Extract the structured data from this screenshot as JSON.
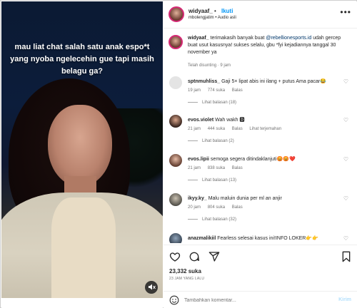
{
  "media": {
    "caption": "mau liat chat salah satu anak espo*t yang nyoba ngelecehin gue tapi masih belagu ga?"
  },
  "header": {
    "username": "widyaaf_",
    "separator": "•",
    "follow_label": "Ikuti",
    "subtitle": "mbolengjatim • Audio asli",
    "more": "•••"
  },
  "post_caption": {
    "username": "widyaaf_",
    "text_before": "terimakasih banyak buat",
    "mention": "@rebellionesports.id",
    "text_after": "udah gercep buat usut kasusnya! sukses selalu, gbu *fyi kejadiannya tanggal 30 november ya",
    "meta": "Telah disunting · 9 jam"
  },
  "comments": [
    {
      "username": "sptnmuhliss_",
      "text": "Gaji 5× lipat abis ini ilang + putus Ama pacar😂",
      "time": "19 jam",
      "likes": "774 suka",
      "reply": "Balas",
      "translate": "",
      "replies": "Lihat balasan (18)"
    },
    {
      "username": "evos.violet",
      "text": "Wah wakh 🅳",
      "time": "21 jam",
      "likes": "444 suka",
      "reply": "Balas",
      "translate": "Lihat terjemahan",
      "replies": "Lihat balasan (2)"
    },
    {
      "username": "evos.lipii",
      "text": "semoga segera ditindaklanjuti😡😡❤️",
      "time": "21 jam",
      "likes": "838 suka",
      "reply": "Balas",
      "translate": "",
      "replies": "Lihat balasan (13)"
    },
    {
      "username": "ikyy.ky_",
      "text": "Malu maluin dunia per ml an anjir",
      "time": "20 jam",
      "likes": "804 suka",
      "reply": "Balas",
      "translate": "",
      "replies": "Lihat balasan (32)"
    },
    {
      "username": "anazmalikiil",
      "text": "Fearless selesai kasus ini!INFO LOKER👉👉",
      "time": "",
      "likes": "",
      "reply": "",
      "translate": "",
      "replies": ""
    }
  ],
  "actions": {
    "likes": "23,332 suka",
    "ago": "23 JAM YANG LALU",
    "placeholder": "Tambahkan komentar...",
    "post_label": "Kirim"
  },
  "icons": {
    "like": "heart-icon",
    "comment": "comment-icon",
    "share": "share-icon",
    "save": "bookmark-icon",
    "emoji": "emoji-icon",
    "mute": "mute-icon",
    "more": "more-icon"
  },
  "colors": {
    "accent": "#0095f6",
    "mention": "#00376b",
    "muted": "#737373",
    "post_disabled": "#b2dffc"
  }
}
